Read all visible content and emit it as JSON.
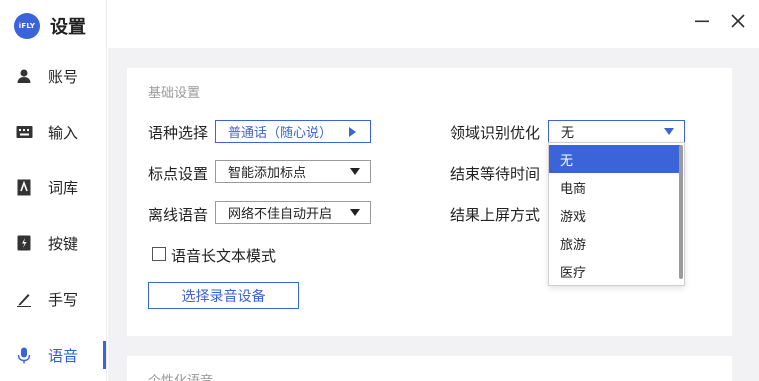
{
  "app": {
    "logo_text": "iFLY",
    "title": "设置"
  },
  "sidebar": {
    "items": [
      {
        "label": "账号",
        "icon": "user-icon"
      },
      {
        "label": "输入",
        "icon": "keyboard-icon"
      },
      {
        "label": "词库",
        "icon": "lexicon-icon"
      },
      {
        "label": "按键",
        "icon": "key-icon"
      },
      {
        "label": "手写",
        "icon": "pen-icon"
      },
      {
        "label": "语音",
        "icon": "microphone-icon"
      }
    ],
    "active": "语音"
  },
  "window": {
    "minimize_icon": "minimize-icon",
    "close_icon": "close-icon"
  },
  "basic": {
    "title": "基础设置",
    "language_label": "语种选择",
    "language_value": "普通话（随心说）",
    "punct_label": "标点设置",
    "punct_value": "智能添加标点",
    "offline_label": "离线语音",
    "offline_value": "网络不佳自动开启",
    "longtext_label": "语音长文本模式",
    "select_device_label": "选择录音设备",
    "domain_label": "领域识别优化",
    "domain_value": "无",
    "end_wait_label": "结束等待时间",
    "screen_mode_label": "结果上屏方式"
  },
  "dropdown": {
    "options": [
      "无",
      "电商",
      "游戏",
      "旅游",
      "医疗"
    ],
    "selected": "无"
  },
  "personal": {
    "title": "个性化语音"
  },
  "colors": {
    "accent": "#3a64d8",
    "background": "#f2f2f4"
  }
}
